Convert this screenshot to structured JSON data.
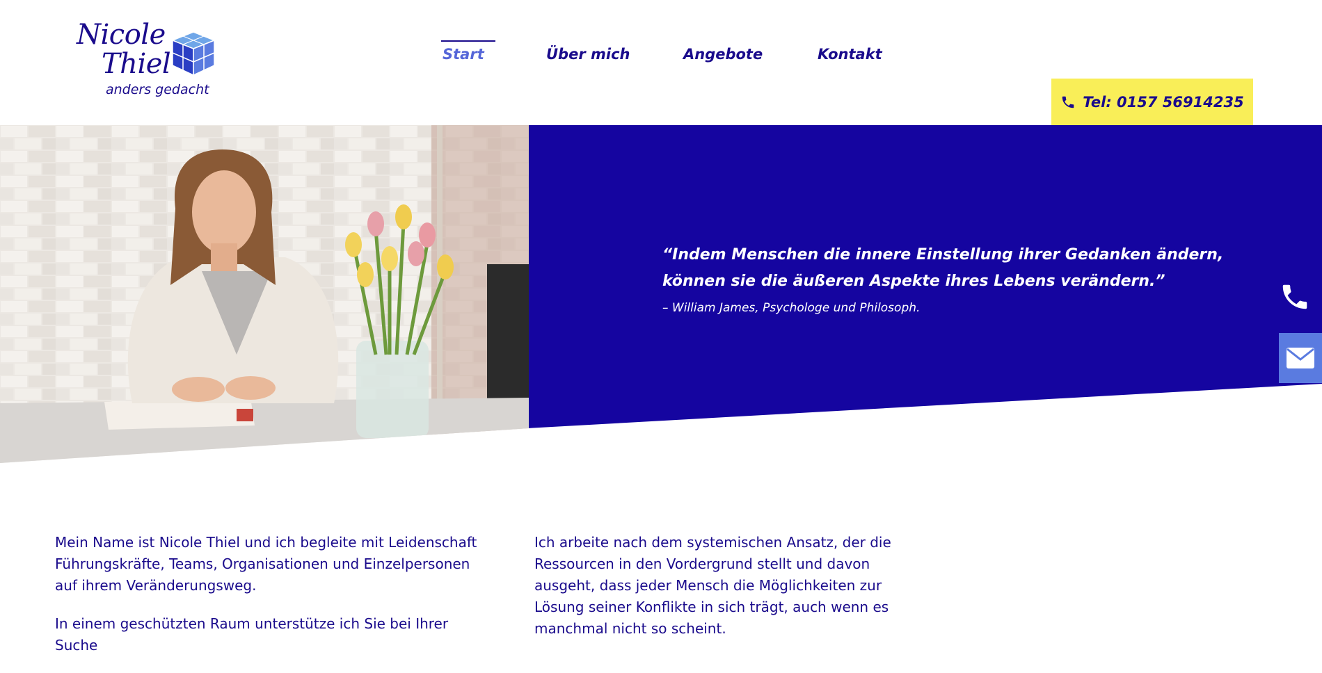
{
  "logo": {
    "name_line1": "Nicole",
    "name_line2": "Thiel",
    "tagline": "anders gedacht",
    "icon": "cube-logo-icon"
  },
  "nav": {
    "items": [
      {
        "label": "Start",
        "active": true
      },
      {
        "label": "Über mich",
        "active": false
      },
      {
        "label": "Angebote",
        "active": false
      },
      {
        "label": "Kontakt",
        "active": false
      }
    ]
  },
  "header": {
    "phone_button_label": "Tel: 0157 56914235",
    "phone_icon": "phone-icon"
  },
  "hero": {
    "image_subject": "portrait-photo",
    "quote": "“Indem Menschen die innere Einstellung ihrer Gedanken ändern, können sie die äußeren Aspekte ihres Lebens verändern.”",
    "author": "– William James, Psychologe und Philosoph."
  },
  "side_contacts": {
    "phone_icon": "phone-icon",
    "mail_icon": "mail-icon"
  },
  "intro": {
    "left_paragraphs": [
      "Mein Name ist Nicole Thiel und ich begleite mit Leidenschaft Führungskräfte, Teams, Organisationen und Einzelpersonen auf ihrem Veränderungsweg.",
      "In einem geschützten Raum unterstütze ich Sie bei Ihrer Suche"
    ],
    "right_paragraphs": [
      "Ich arbeite nach dem systemischen Ansatz, der die Ressourcen in den Vordergrund stellt und davon ausgeht, dass jeder Mensch die Möglichkeiten zur Lösung seiner Konflikte in sich trägt, auch wenn es manchmal nicht so scheint."
    ]
  },
  "colors": {
    "primary_blue": "#1a0b8c",
    "hero_blue": "#1505a0",
    "accent_yellow": "#f9ee58",
    "light_blue": "#5a7be0",
    "active_nav": "#5566d8"
  }
}
